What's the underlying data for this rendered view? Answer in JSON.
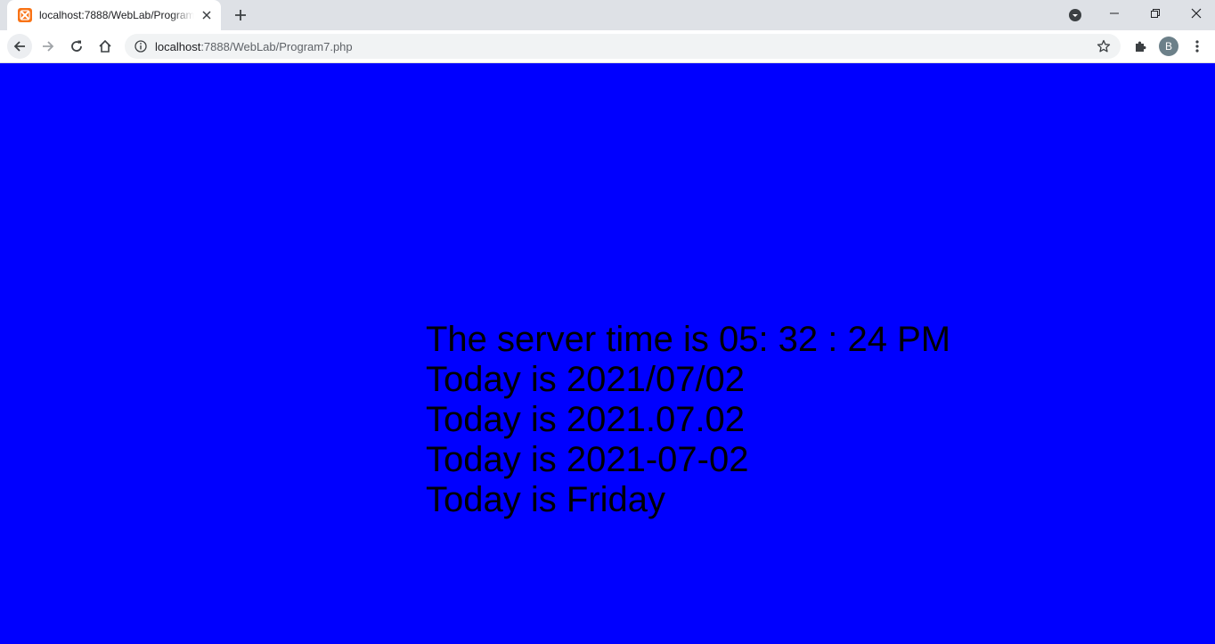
{
  "browser": {
    "tab": {
      "title": "localhost:7888/WebLab/Program7.php",
      "favicon": "xampp-icon"
    },
    "address": {
      "host": "localhost",
      "rest": ":7888/WebLab/Program7.php"
    },
    "profile_initial": "B"
  },
  "page": {
    "background_color": "#0000ff",
    "lines": [
      "The server time is 05: 32 : 24 PM",
      "Today is 2021/07/02",
      "Today is 2021.07.02",
      "Today is 2021-07-02",
      "Today is Friday"
    ]
  }
}
